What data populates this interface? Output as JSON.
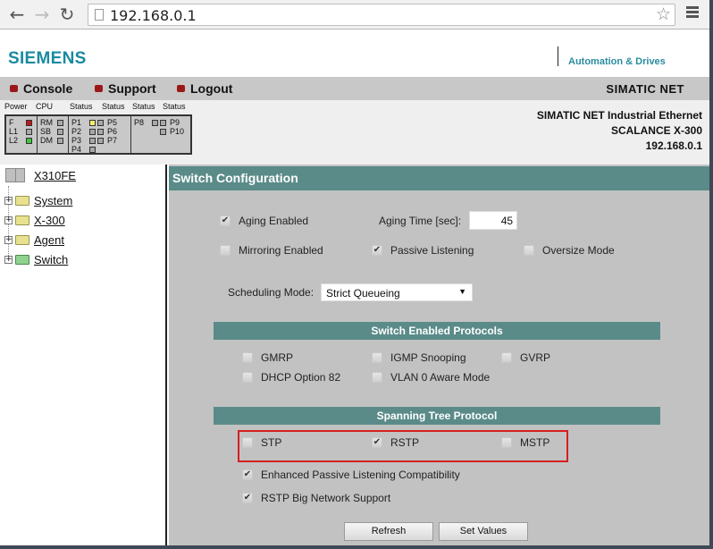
{
  "browser": {
    "url": "192.168.0.1",
    "back_icon": "←",
    "forward_icon": "→",
    "reload_icon": "↻",
    "star_icon": "☆"
  },
  "header": {
    "logo": "SIEMENS",
    "tagline": "Automation & Drives",
    "menu": [
      {
        "label": "Console"
      },
      {
        "label": "Support"
      },
      {
        "label": "Logout"
      }
    ],
    "product_line": "SIMATIC NET",
    "device_title": "SIMATIC NET Industrial Ethernet",
    "device_model": "SCALANCE X-300",
    "device_ip": "192.168.0.1"
  },
  "led_panel": {
    "headers": [
      "Power",
      "CPU",
      "Status",
      "Status",
      "Status",
      "Status"
    ],
    "power": [
      {
        "label": "F",
        "state": "red"
      },
      {
        "label": "L1",
        "state": "off"
      },
      {
        "label": "L2",
        "state": "green"
      }
    ],
    "cpu": [
      {
        "label": "RM",
        "state": "off"
      },
      {
        "label": "SB",
        "state": "off"
      },
      {
        "label": "DM",
        "state": "off"
      }
    ],
    "ports_a": [
      "P1",
      "P2",
      "P3",
      "P4"
    ],
    "ports_b": [
      "P5",
      "P6",
      "P7"
    ],
    "ports_c": [
      "P8"
    ],
    "ports_d": [
      "P9",
      "P10"
    ]
  },
  "sidebar": {
    "root": "X310FE",
    "items": [
      {
        "label": "System",
        "expander": "+"
      },
      {
        "label": "X-300",
        "expander": "+"
      },
      {
        "label": "Agent",
        "expander": "+"
      },
      {
        "label": "Switch",
        "expander": "+"
      }
    ]
  },
  "main": {
    "title": "Switch Configuration",
    "aging_enabled": {
      "label": "Aging Enabled",
      "checked": true
    },
    "aging_time": {
      "label": "Aging Time [sec]:",
      "value": "45"
    },
    "mirroring_enabled": {
      "label": "Mirroring Enabled",
      "checked": false
    },
    "passive_listening": {
      "label": "Passive Listening",
      "checked": true
    },
    "oversize_mode": {
      "label": "Oversize Mode",
      "checked": false
    },
    "scheduling_mode": {
      "label": "Scheduling Mode:",
      "value": "Strict Queueing"
    },
    "protocols_title": "Switch Enabled Protocols",
    "protocols": [
      {
        "label": "GMRP",
        "checked": false
      },
      {
        "label": "IGMP Snooping",
        "checked": false
      },
      {
        "label": "GVRP",
        "checked": false
      },
      {
        "label": "DHCP Option 82",
        "checked": false
      },
      {
        "label": "VLAN 0 Aware Mode",
        "checked": false
      }
    ],
    "stp_title": "Spanning Tree Protocol",
    "stp": [
      {
        "label": "STP",
        "checked": false
      },
      {
        "label": "RSTP",
        "checked": true
      },
      {
        "label": "MSTP",
        "checked": false
      }
    ],
    "enhanced_passive": {
      "label": "Enhanced Passive Listening Compatibility",
      "checked": true
    },
    "rstp_big": {
      "label": "RSTP Big Network Support",
      "checked": true
    },
    "check_mark": "✔",
    "refresh_label": "Refresh",
    "set_values_label": "Set Values"
  }
}
